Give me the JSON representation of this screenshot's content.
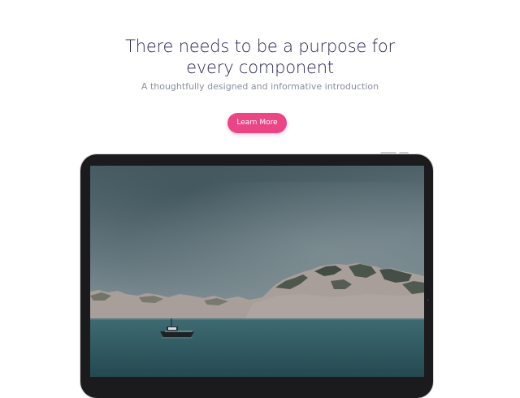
{
  "hero": {
    "title_line1": "There needs to be a purpose for",
    "title_line2": "every component",
    "subtitle": "A thoughtfully designed and informative introduction",
    "cta_label": "Learn More"
  },
  "colors": {
    "title": "#2a2657",
    "subtitle": "#8a8fa0",
    "cta_background": "#ec4586",
    "device_frame": "#1b1b1d"
  },
  "device": {
    "type": "tablet",
    "image": "seascape with rocky hills and a small boat"
  }
}
